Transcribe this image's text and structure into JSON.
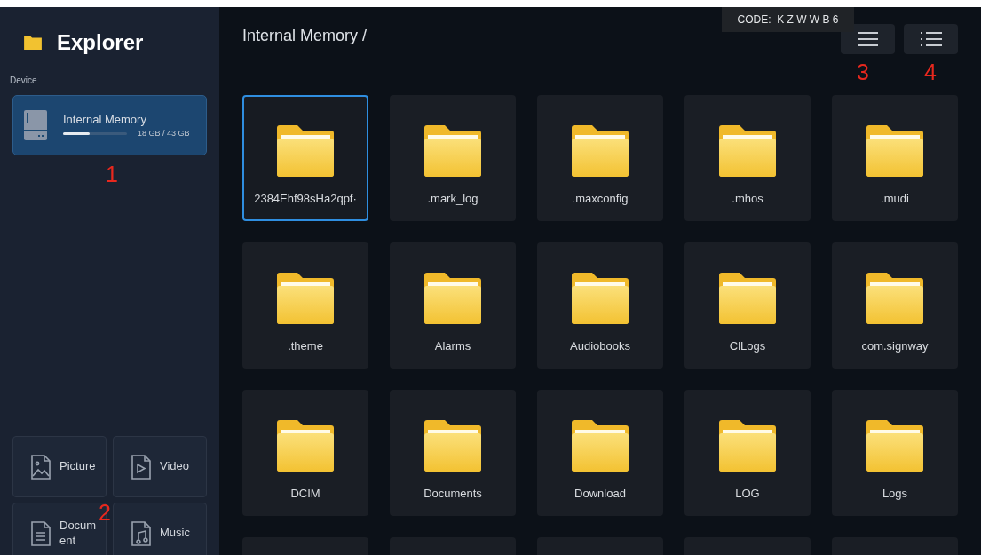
{
  "sidebar": {
    "title": "Explorer",
    "section_label": "Device",
    "storage": {
      "name": "Internal Memory",
      "usage": "18 GB / 43 GB",
      "level": 0.42,
      "selected": true
    },
    "categories": [
      {
        "kind": "picture",
        "label": "Picture"
      },
      {
        "kind": "video",
        "label": "Video"
      },
      {
        "kind": "document",
        "label": "Document"
      },
      {
        "kind": "music",
        "label": "Music"
      }
    ]
  },
  "path": "Internal Memory /",
  "code_tooltip": "CODE:  K Z W W B 6",
  "toolbar": [
    {
      "kind": "menu"
    },
    {
      "kind": "list"
    }
  ],
  "folders": [
    {
      "name": "2384Ehf98sHa2qpf·",
      "selected": true
    },
    {
      "name": ".mark_log",
      "selected": false
    },
    {
      "name": ".maxconfig",
      "selected": false
    },
    {
      "name": ".mhos",
      "selected": false
    },
    {
      "name": ".mudi",
      "selected": false
    },
    {
      "name": ".theme",
      "selected": false
    },
    {
      "name": "Alarms",
      "selected": false
    },
    {
      "name": "Audiobooks",
      "selected": false
    },
    {
      "name": "ClLogs",
      "selected": false
    },
    {
      "name": "com.signway",
      "selected": false
    },
    {
      "name": "DCIM",
      "selected": false
    },
    {
      "name": "Documents",
      "selected": false
    },
    {
      "name": "Download",
      "selected": false
    },
    {
      "name": "LOG",
      "selected": false
    },
    {
      "name": "Logs",
      "selected": false
    }
  ],
  "cut_off_tiles": [
    {
      "selected": false
    },
    {
      "selected": false
    },
    {
      "selected": false
    },
    {
      "selected": false
    },
    {
      "selected": false
    }
  ],
  "annotations": [
    {
      "text": "1",
      "kind": "storage"
    },
    {
      "text": "2",
      "kind": "categories"
    },
    {
      "text": "3",
      "kind": "menu"
    },
    {
      "text": "4",
      "kind": "list"
    }
  ]
}
